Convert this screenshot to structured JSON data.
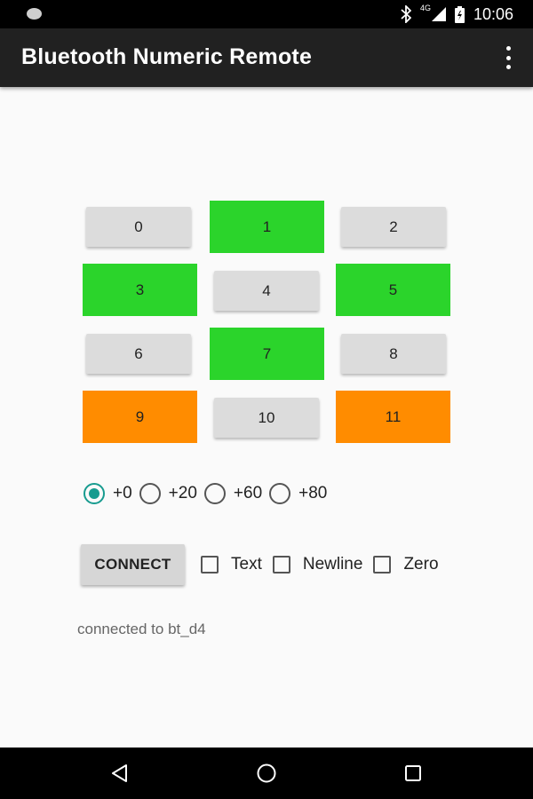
{
  "status_bar": {
    "time": "10:06",
    "network_label": "4G",
    "icons": [
      "notification-dot-icon",
      "bluetooth-icon",
      "signal-icon",
      "battery-icon"
    ]
  },
  "app_bar": {
    "title": "Bluetooth Numeric Remote",
    "menu_icon": "overflow-menu-icon"
  },
  "keypad": {
    "buttons": [
      {
        "label": "0",
        "style": "gray"
      },
      {
        "label": "1",
        "style": "green"
      },
      {
        "label": "2",
        "style": "gray"
      },
      {
        "label": "3",
        "style": "green"
      },
      {
        "label": "4",
        "style": "gray"
      },
      {
        "label": "5",
        "style": "green"
      },
      {
        "label": "6",
        "style": "gray"
      },
      {
        "label": "7",
        "style": "green"
      },
      {
        "label": "8",
        "style": "gray"
      },
      {
        "label": "9",
        "style": "orange"
      },
      {
        "label": "10",
        "style": "gray"
      },
      {
        "label": "11",
        "style": "orange"
      }
    ]
  },
  "offsets": {
    "selected": "+0",
    "options": [
      {
        "label": "+0",
        "checked": true
      },
      {
        "label": "+20",
        "checked": false
      },
      {
        "label": "+60",
        "checked": false
      },
      {
        "label": "+80",
        "checked": false
      }
    ]
  },
  "controls": {
    "connect_label": "CONNECT",
    "checkboxes": [
      {
        "label": "Text",
        "checked": false
      },
      {
        "label": "Newline",
        "checked": false
      },
      {
        "label": "Zero",
        "checked": false
      }
    ]
  },
  "status_message": "connected to bt_d4",
  "nav_bar": {
    "icons": [
      "back-icon",
      "home-icon",
      "recents-icon"
    ]
  },
  "colors": {
    "green": "#2bd42b",
    "orange": "#ff8c00",
    "gray": "#dcdcdc",
    "accent": "#179b8f",
    "app_bar": "#212121"
  }
}
